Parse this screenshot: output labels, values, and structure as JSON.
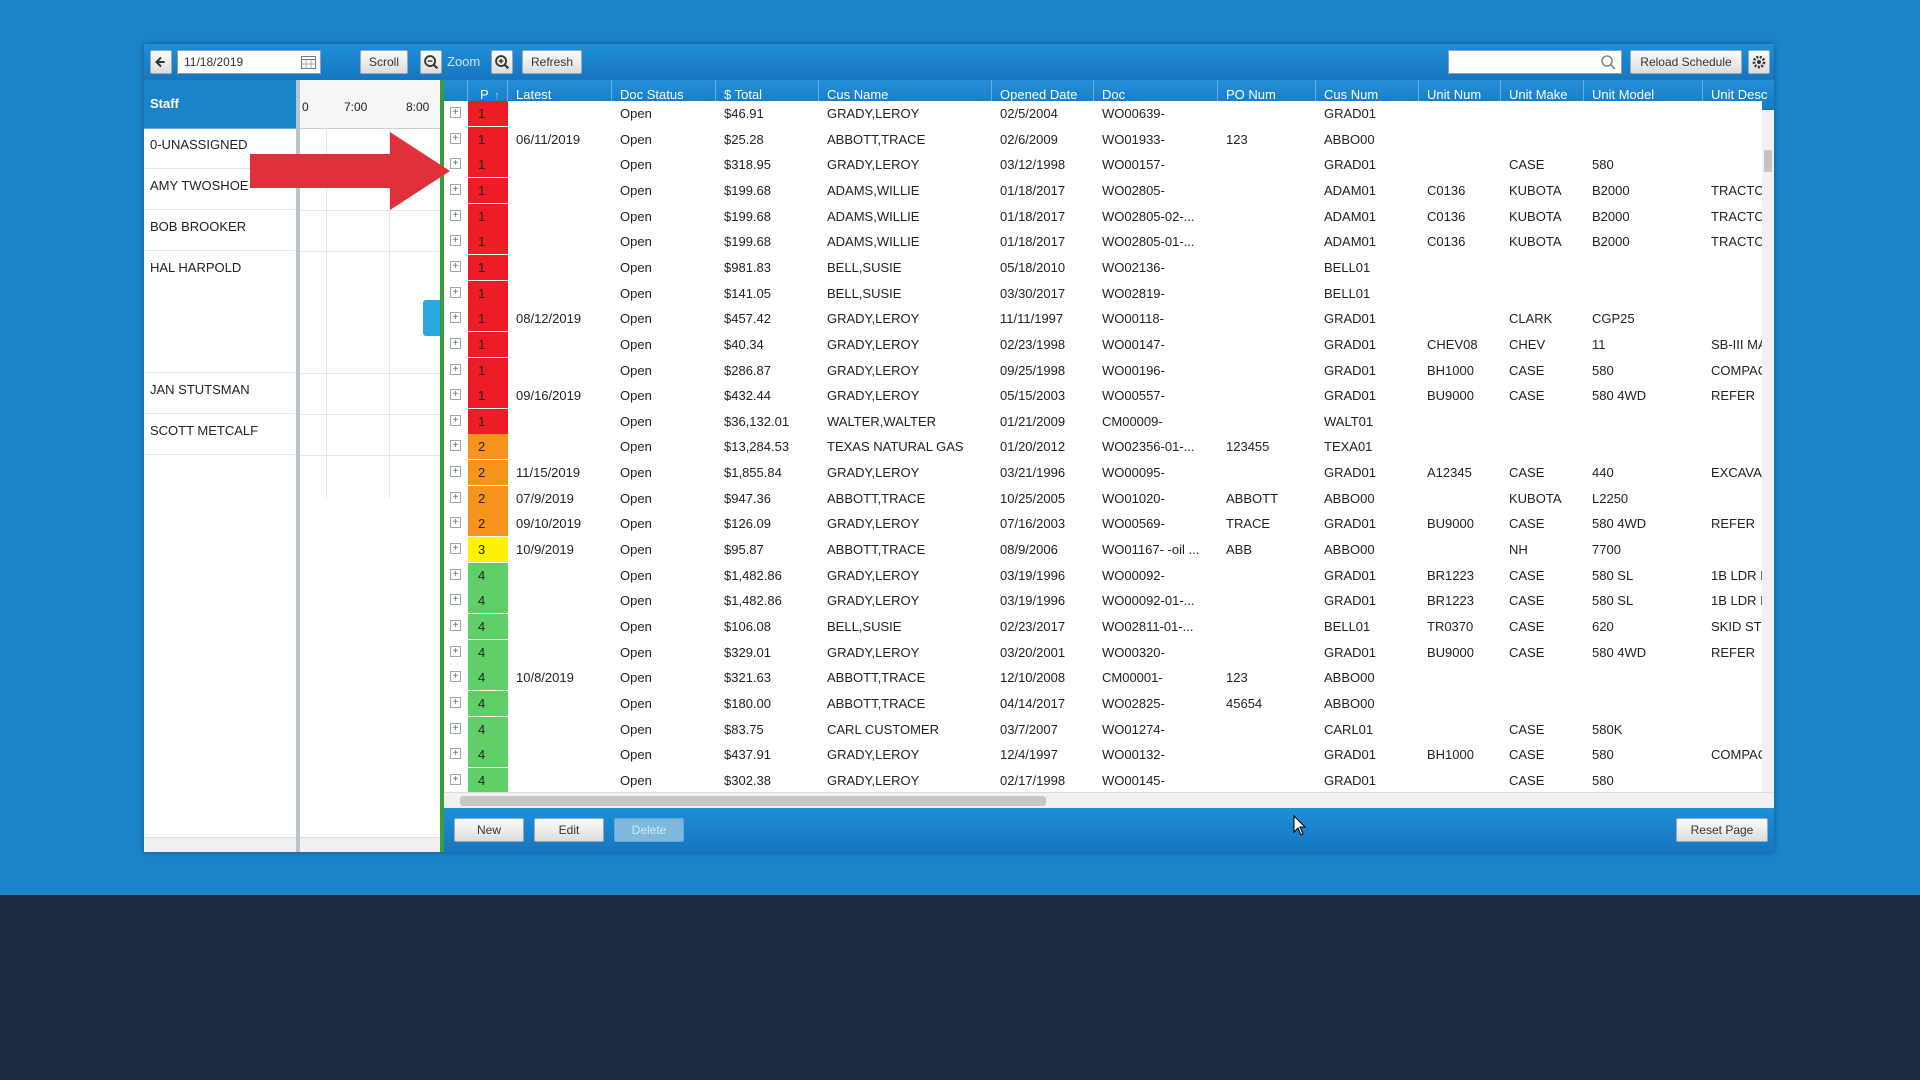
{
  "toolbar": {
    "date": "11/18/2019",
    "scroll_label": "Scroll",
    "zoom_label": "Zoom",
    "refresh_label": "Refresh",
    "search_value": "",
    "reload_label": "Reload Schedule"
  },
  "staff": {
    "header": "Staff",
    "members": [
      "0-UNASSIGNED",
      "AMY TWOSHOE",
      "BOB BROOKER",
      "HAL HARPOLD",
      "JAN STUTSMAN",
      "SCOTT METCALF"
    ]
  },
  "timeline": {
    "ticks": [
      "0",
      "7:00",
      "8:00"
    ]
  },
  "grid": {
    "columns": [
      "P",
      "Latest",
      "Doc Status",
      "$ Total",
      "Cus Name",
      "Opened Date",
      "Doc",
      "PO Num",
      "Cus Num",
      "Unit Num",
      "Unit Make",
      "Unit Model",
      "Unit Desc"
    ],
    "priority_colors": {
      "1": "#ee1c25",
      "2": "#f7941d",
      "3": "#fff200",
      "4": "#5fd068"
    },
    "rows": [
      {
        "p": "1",
        "latest": "",
        "status": "Open",
        "total": "$46.91",
        "cus_name": "GRADY,LEROY",
        "opened": "02/5/2004",
        "doc": "WO00639-",
        "po": "",
        "cus_num": "GRAD01",
        "unit_num": "",
        "make": "",
        "model": "",
        "desc": ""
      },
      {
        "p": "1",
        "latest": "06/11/2019",
        "status": "Open",
        "total": "$25.28",
        "cus_name": "ABBOTT,TRACE",
        "opened": "02/6/2009",
        "doc": "WO01933-",
        "po": "123",
        "cus_num": "ABBO00",
        "unit_num": "",
        "make": "",
        "model": "",
        "desc": ""
      },
      {
        "p": "1",
        "latest": "",
        "status": "Open",
        "total": "$318.95",
        "cus_name": "GRADY,LEROY",
        "opened": "03/12/1998",
        "doc": "WO00157-",
        "po": "",
        "cus_num": "GRAD01",
        "unit_num": "",
        "make": "CASE",
        "model": "580",
        "desc": ""
      },
      {
        "p": "1",
        "latest": "",
        "status": "Open",
        "total": "$199.68",
        "cus_name": "ADAMS,WILLIE",
        "opened": "01/18/2017",
        "doc": "WO02805-",
        "po": "",
        "cus_num": "ADAM01",
        "unit_num": "C0136",
        "make": "KUBOTA",
        "model": "B2000",
        "desc": "TRACTC"
      },
      {
        "p": "1",
        "latest": "",
        "status": "Open",
        "total": "$199.68",
        "cus_name": "ADAMS,WILLIE",
        "opened": "01/18/2017",
        "doc": "WO02805-02-...",
        "po": "",
        "cus_num": "ADAM01",
        "unit_num": "C0136",
        "make": "KUBOTA",
        "model": "B2000",
        "desc": "TRACTC"
      },
      {
        "p": "1",
        "latest": "",
        "status": "Open",
        "total": "$199.68",
        "cus_name": "ADAMS,WILLIE",
        "opened": "01/18/2017",
        "doc": "WO02805-01-...",
        "po": "",
        "cus_num": "ADAM01",
        "unit_num": "C0136",
        "make": "KUBOTA",
        "model": "B2000",
        "desc": "TRACTC"
      },
      {
        "p": "1",
        "latest": "",
        "status": "Open",
        "total": "$981.83",
        "cus_name": "BELL,SUSIE",
        "opened": "05/18/2010",
        "doc": "WO02136-",
        "po": "",
        "cus_num": "BELL01",
        "unit_num": "",
        "make": "",
        "model": "",
        "desc": ""
      },
      {
        "p": "1",
        "latest": "",
        "status": "Open",
        "total": "$141.05",
        "cus_name": "BELL,SUSIE",
        "opened": "03/30/2017",
        "doc": "WO02819-",
        "po": "",
        "cus_num": "BELL01",
        "unit_num": "",
        "make": "",
        "model": "",
        "desc": ""
      },
      {
        "p": "1",
        "latest": "08/12/2019",
        "status": "Open",
        "total": "$457.42",
        "cus_name": "GRADY,LEROY",
        "opened": "11/11/1997",
        "doc": "WO00118-",
        "po": "",
        "cus_num": "GRAD01",
        "unit_num": "",
        "make": "CLARK",
        "model": "CGP25",
        "desc": ""
      },
      {
        "p": "1",
        "latest": "",
        "status": "Open",
        "total": "$40.34",
        "cus_name": "GRADY,LEROY",
        "opened": "02/23/1998",
        "doc": "WO00147-",
        "po": "",
        "cus_num": "GRAD01",
        "unit_num": "CHEV08",
        "make": "CHEV",
        "model": "11",
        "desc": "SB-III MA"
      },
      {
        "p": "1",
        "latest": "",
        "status": "Open",
        "total": "$286.87",
        "cus_name": "GRADY,LEROY",
        "opened": "09/25/1998",
        "doc": "WO00196-",
        "po": "",
        "cus_num": "GRAD01",
        "unit_num": "BH1000",
        "make": "CASE",
        "model": "580",
        "desc": "COMPAC"
      },
      {
        "p": "1",
        "latest": "09/16/2019",
        "status": "Open",
        "total": "$432.44",
        "cus_name": "GRADY,LEROY",
        "opened": "05/15/2003",
        "doc": "WO00557-",
        "po": "",
        "cus_num": "GRAD01",
        "unit_num": "BU9000",
        "make": "CASE",
        "model": "580 4WD",
        "desc": "REFER"
      },
      {
        "p": "1",
        "latest": "",
        "status": "Open",
        "total": "$36,132.01",
        "cus_name": "WALTER,WALTER",
        "opened": "01/21/2009",
        "doc": "CM00009-",
        "po": "",
        "cus_num": "WALT01",
        "unit_num": "",
        "make": "",
        "model": "",
        "desc": ""
      },
      {
        "p": "2",
        "latest": "",
        "status": "Open",
        "total": "$13,284.53",
        "cus_name": "TEXAS NATURAL GAS",
        "opened": "01/20/2012",
        "doc": "WO02356-01-...",
        "po": "123455",
        "cus_num": "TEXA01",
        "unit_num": "",
        "make": "",
        "model": "",
        "desc": ""
      },
      {
        "p": "2",
        "latest": "11/15/2019",
        "status": "Open",
        "total": "$1,855.84",
        "cus_name": "GRADY,LEROY",
        "opened": "03/21/1996",
        "doc": "WO00095-",
        "po": "",
        "cus_num": "GRAD01",
        "unit_num": "A12345",
        "make": "CASE",
        "model": "440",
        "desc": "EXCAVA"
      },
      {
        "p": "2",
        "latest": "07/9/2019",
        "status": "Open",
        "total": "$947.36",
        "cus_name": "ABBOTT,TRACE",
        "opened": "10/25/2005",
        "doc": "WO01020-",
        "po": "ABBOTT",
        "cus_num": "ABBO00",
        "unit_num": "",
        "make": "KUBOTA",
        "model": "L2250",
        "desc": ""
      },
      {
        "p": "2",
        "latest": "09/10/2019",
        "status": "Open",
        "total": "$126.09",
        "cus_name": "GRADY,LEROY",
        "opened": "07/16/2003",
        "doc": "WO00569-",
        "po": "TRACE",
        "cus_num": "GRAD01",
        "unit_num": "BU9000",
        "make": "CASE",
        "model": "580 4WD",
        "desc": "REFER"
      },
      {
        "p": "3",
        "latest": "10/9/2019",
        "status": "Open",
        "total": "$95.87",
        "cus_name": "ABBOTT,TRACE",
        "opened": "08/9/2006",
        "doc": "WO01167- -oil ...",
        "po": "ABB",
        "cus_num": "ABBO00",
        "unit_num": "",
        "make": "NH",
        "model": "7700",
        "desc": ""
      },
      {
        "p": "4",
        "latest": "",
        "status": "Open",
        "total": "$1,482.86",
        "cus_name": "GRADY,LEROY",
        "opened": "03/19/1996",
        "doc": "WO00092-",
        "po": "",
        "cus_num": "GRAD01",
        "unit_num": "BR1223",
        "make": "CASE",
        "model": "580 SL",
        "desc": "1B LDR I"
      },
      {
        "p": "4",
        "latest": "",
        "status": "Open",
        "total": "$1,482.86",
        "cus_name": "GRADY,LEROY",
        "opened": "03/19/1996",
        "doc": "WO00092-01-...",
        "po": "",
        "cus_num": "GRAD01",
        "unit_num": "BR1223",
        "make": "CASE",
        "model": "580 SL",
        "desc": "1B LDR I"
      },
      {
        "p": "4",
        "latest": "",
        "status": "Open",
        "total": "$106.08",
        "cus_name": "BELL,SUSIE",
        "opened": "02/23/2017",
        "doc": "WO02811-01-...",
        "po": "",
        "cus_num": "BELL01",
        "unit_num": "TR0370",
        "make": "CASE",
        "model": "620",
        "desc": "SKID ST"
      },
      {
        "p": "4",
        "latest": "",
        "status": "Open",
        "total": "$329.01",
        "cus_name": "GRADY,LEROY",
        "opened": "03/20/2001",
        "doc": "WO00320-",
        "po": "",
        "cus_num": "GRAD01",
        "unit_num": "BU9000",
        "make": "CASE",
        "model": "580 4WD",
        "desc": "REFER"
      },
      {
        "p": "4",
        "latest": "10/8/2019",
        "status": "Open",
        "total": "$321.63",
        "cus_name": "ABBOTT,TRACE",
        "opened": "12/10/2008",
        "doc": "CM00001-",
        "po": "123",
        "cus_num": "ABBO00",
        "unit_num": "",
        "make": "",
        "model": "",
        "desc": ""
      },
      {
        "p": "4",
        "latest": "",
        "status": "Open",
        "total": "$180.00",
        "cus_name": "ABBOTT,TRACE",
        "opened": "04/14/2017",
        "doc": "WO02825-",
        "po": "45654",
        "cus_num": "ABBO00",
        "unit_num": "",
        "make": "",
        "model": "",
        "desc": ""
      },
      {
        "p": "4",
        "latest": "",
        "status": "Open",
        "total": "$83.75",
        "cus_name": "CARL CUSTOMER",
        "opened": "03/7/2007",
        "doc": "WO01274-",
        "po": "",
        "cus_num": "CARL01",
        "unit_num": "",
        "make": "CASE",
        "model": "580K",
        "desc": ""
      },
      {
        "p": "4",
        "latest": "",
        "status": "Open",
        "total": "$437.91",
        "cus_name": "GRADY,LEROY",
        "opened": "12/4/1997",
        "doc": "WO00132-",
        "po": "",
        "cus_num": "GRAD01",
        "unit_num": "BH1000",
        "make": "CASE",
        "model": "580",
        "desc": "COMPAC"
      },
      {
        "p": "4",
        "latest": "",
        "status": "Open",
        "total": "$302.38",
        "cus_name": "GRADY,LEROY",
        "opened": "02/17/1998",
        "doc": "WO00145-",
        "po": "",
        "cus_num": "GRAD01",
        "unit_num": "",
        "make": "CASE",
        "model": "580",
        "desc": ""
      }
    ]
  },
  "bottom_bar": {
    "new_label": "New",
    "edit_label": "Edit",
    "delete_label": "Delete",
    "reset_label": "Reset Page"
  },
  "colors": {
    "accent": "#1b84c9",
    "annotation_arrow": "#e0303c",
    "dark_band": "#1d2b42"
  }
}
